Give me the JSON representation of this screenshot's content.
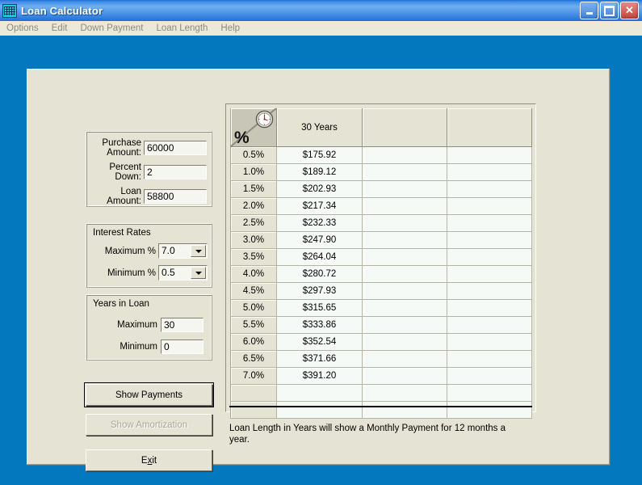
{
  "window": {
    "title": "Loan Calculator",
    "icon": "calculator-icon",
    "buttons": {
      "minimize": "_",
      "maximize": "□",
      "close": "✕"
    }
  },
  "menubar": {
    "items": [
      {
        "label": "Options"
      },
      {
        "label": "Edit"
      },
      {
        "label": "Down Payment"
      },
      {
        "label": "Loan Length"
      },
      {
        "label": "Help"
      }
    ]
  },
  "amount_group": {
    "purchase_label_l1": "Purchase",
    "purchase_label_l2": "Amount:",
    "purchase_value": "60000",
    "percent_label_l1": "Percent",
    "percent_label_l2": "Down:",
    "percent_value": "2",
    "loan_label_l1": "Loan",
    "loan_label_l2": "Amount:",
    "loan_value": "58800"
  },
  "interest_group": {
    "title": "Interest Rates",
    "maximum_label": "Maximum %",
    "maximum_value": "7.0",
    "minimum_label": "Minimum %",
    "minimum_value": "0.5"
  },
  "years_group": {
    "title": "Years in Loan",
    "maximum_label": "Maximum",
    "maximum_value": "30",
    "minimum_label": "Minimum",
    "minimum_value": "0"
  },
  "buttons": {
    "show_payments": "Show Payments",
    "show_amortization": "Show Amortization",
    "exit_pre": "E",
    "exit_mnemonic": "x",
    "exit_post": "it"
  },
  "grid": {
    "corner_percent_symbol": "%",
    "corner_icon": "clock-icon",
    "headers": [
      "",
      "30 Years",
      "",
      ""
    ],
    "rows": [
      {
        "rate": "0.5%",
        "payment": "$175.92",
        "c3": "",
        "c4": ""
      },
      {
        "rate": "1.0%",
        "payment": "$189.12",
        "c3": "",
        "c4": ""
      },
      {
        "rate": "1.5%",
        "payment": "$202.93",
        "c3": "",
        "c4": ""
      },
      {
        "rate": "2.0%",
        "payment": "$217.34",
        "c3": "",
        "c4": ""
      },
      {
        "rate": "2.5%",
        "payment": "$232.33",
        "c3": "",
        "c4": ""
      },
      {
        "rate": "3.0%",
        "payment": "$247.90",
        "c3": "",
        "c4": ""
      },
      {
        "rate": "3.5%",
        "payment": "$264.04",
        "c3": "",
        "c4": ""
      },
      {
        "rate": "4.0%",
        "payment": "$280.72",
        "c3": "",
        "c4": ""
      },
      {
        "rate": "4.5%",
        "payment": "$297.93",
        "c3": "",
        "c4": ""
      },
      {
        "rate": "5.0%",
        "payment": "$315.65",
        "c3": "",
        "c4": ""
      },
      {
        "rate": "5.5%",
        "payment": "$333.86",
        "c3": "",
        "c4": ""
      },
      {
        "rate": "6.0%",
        "payment": "$352.54",
        "c3": "",
        "c4": ""
      },
      {
        "rate": "6.5%",
        "payment": "$371.66",
        "c3": "",
        "c4": ""
      },
      {
        "rate": "7.0%",
        "payment": "$391.20",
        "c3": "",
        "c4": ""
      },
      {
        "rate": "",
        "payment": "",
        "c3": "",
        "c4": ""
      },
      {
        "rate": "",
        "payment": "",
        "c3": "",
        "c4": ""
      }
    ]
  },
  "caption": {
    "text": "Loan Length in Years will show a Monthly Payment for 12 months a year."
  },
  "colors": {
    "desktop_blue": "#0478be",
    "panel_beige": "#e5e3d3",
    "grid_cell": "#f6faf6",
    "title_blue": "#3e8ae4",
    "close_red": "#c1453d"
  }
}
